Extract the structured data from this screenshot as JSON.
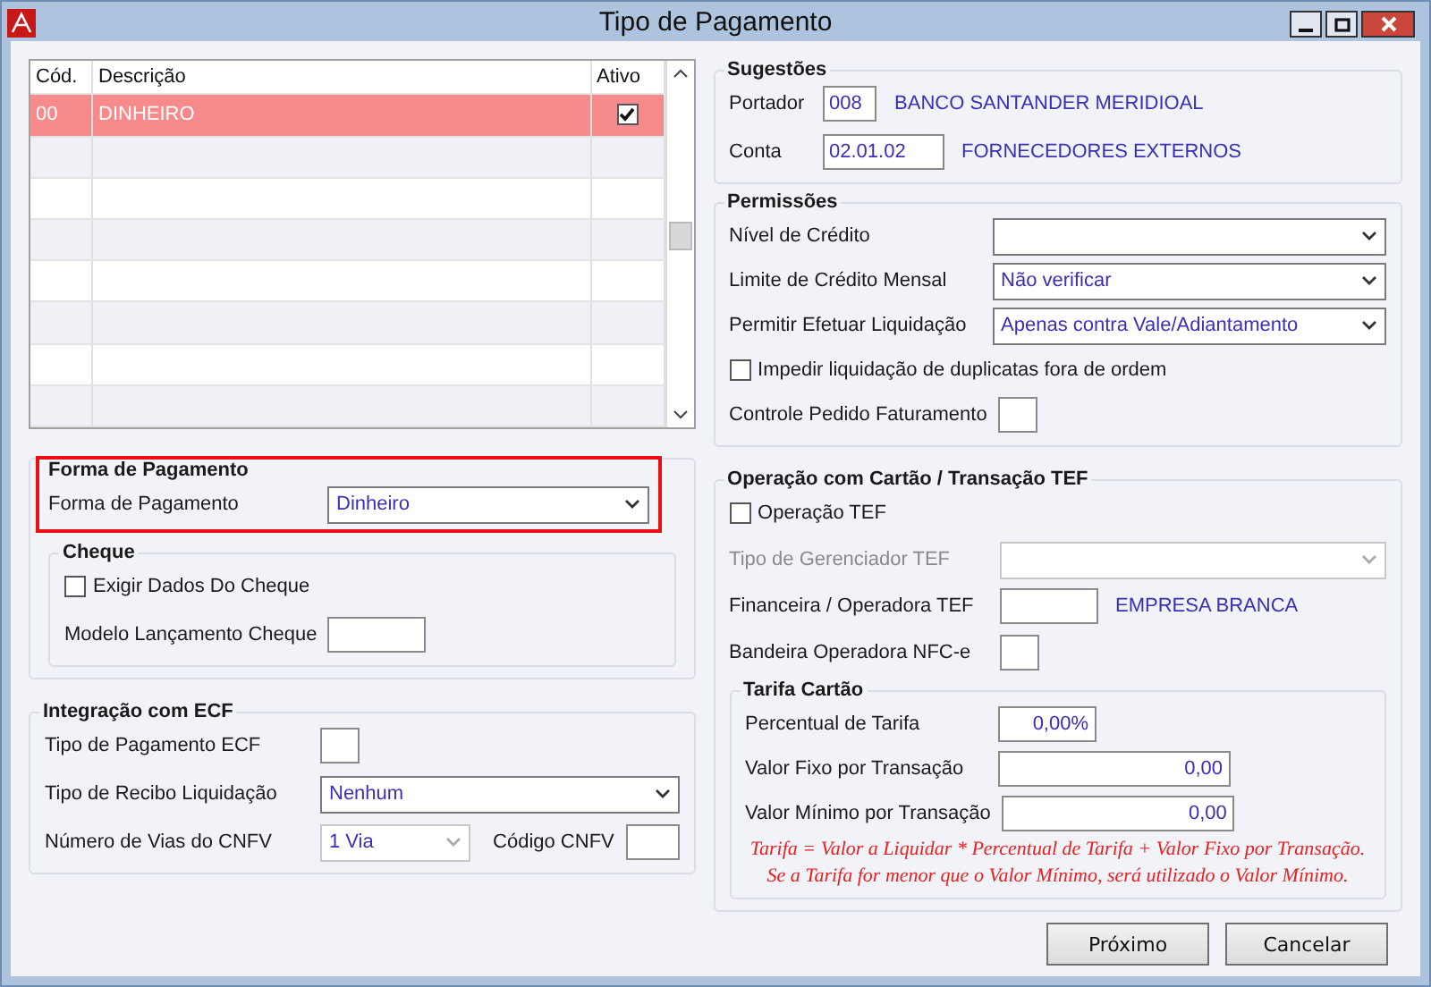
{
  "window": {
    "title": "Tipo de Pagamento"
  },
  "grid": {
    "columns": [
      "Cód.",
      "Descrição",
      "Ativo"
    ],
    "rows": [
      {
        "code": "00",
        "description": "DINHEIRO",
        "active": true,
        "selected": true
      }
    ]
  },
  "forma_pagamento": {
    "title": "Forma de Pagamento",
    "highlighted": true,
    "fields": [
      {
        "kind": "select",
        "label": "Forma de Pagamento",
        "value": "Dinheiro"
      }
    ],
    "cheque": {
      "title": "Cheque",
      "fields": [
        {
          "kind": "checkbox",
          "label": "Exigir Dados Do Cheque",
          "checked": false
        },
        {
          "kind": "lookup",
          "label": "Modelo Lançamento Cheque"
        }
      ]
    }
  },
  "integracao_ecf": {
    "title": "Integração com ECF",
    "fields": [
      {
        "kind": "lookup",
        "label": "Tipo de Pagamento ECF"
      },
      {
        "kind": "select",
        "label": "Tipo de Recibo Liquidação",
        "value": "Nenhum"
      },
      {
        "kind": "pair",
        "items": [
          {
            "kind": "select",
            "label": "Número de Vias do CNFV",
            "value": "1 Via"
          },
          {
            "kind": "lookup",
            "label": "Código CNFV"
          }
        ]
      }
    ]
  },
  "sugestoes": {
    "title": "Sugestões",
    "fields": [
      {
        "kind": "lookup",
        "label": "Portador",
        "value": "008",
        "description": "BANCO SANTANDER MERIDIOAL"
      },
      {
        "kind": "lookup",
        "label": "Conta",
        "value": "02.01.02",
        "description": "FORNECEDORES EXTERNOS"
      }
    ]
  },
  "permissoes": {
    "title": "Permissões",
    "fields": [
      {
        "kind": "select",
        "label": "Nível de Crédito"
      },
      {
        "kind": "select",
        "label": "Limite de Crédito Mensal",
        "value": "Não verificar"
      },
      {
        "kind": "select",
        "label": "Permitir Efetuar Liquidação",
        "value": "Apenas contra Vale/Adiantamento"
      },
      {
        "kind": "checkbox",
        "label": "Impedir liquidação de duplicatas fora de ordem",
        "checked": false
      },
      {
        "kind": "lookup",
        "label": "Controle Pedido Faturamento"
      }
    ]
  },
  "operacao_tef": {
    "title": "Operação com Cartão / Transação TEF",
    "fields": [
      {
        "kind": "checkbox",
        "label": "Operação TEF",
        "checked": false
      },
      {
        "kind": "select",
        "label": "Tipo de Gerenciador TEF",
        "disabled": true
      },
      {
        "kind": "lookup",
        "label": "Financeira / Operadora TEF",
        "description": "EMPRESA BRANCA"
      },
      {
        "kind": "lookup",
        "label": "Bandeira Operadora NFC-e"
      }
    ],
    "tarifa": {
      "title": "Tarifa Cartão",
      "fields": [
        {
          "kind": "number",
          "label": "Percentual de Tarifa",
          "value": "0,00%"
        },
        {
          "kind": "number",
          "label": "Valor Fixo por Transação",
          "value": "0,00"
        },
        {
          "kind": "number",
          "label": "Valor Mínimo por Transação",
          "value": "0,00"
        }
      ],
      "note": [
        "Tarifa = Valor a Liquidar *  Percentual de Tarifa + Valor Fixo por Transação.",
        "Se a Tarifa for menor que o Valor Mínimo, será utilizado o Valor Mínimo."
      ]
    }
  },
  "buttons": [
    "Próximo",
    "Cancelar"
  ]
}
